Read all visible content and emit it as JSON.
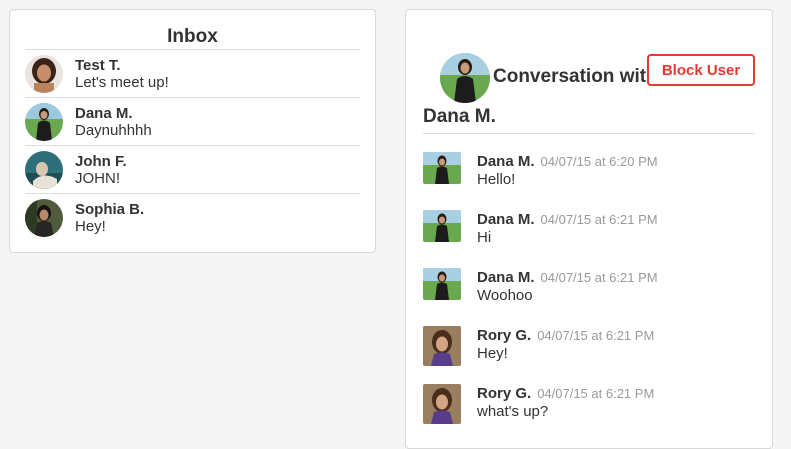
{
  "inbox": {
    "title": "Inbox",
    "items": [
      {
        "name": "Test T.",
        "message": "Let's meet up!"
      },
      {
        "name": "Dana M.",
        "message": "Daynuhhhh"
      },
      {
        "name": "John F.",
        "message": "JOHN!"
      },
      {
        "name": "Sophia B.",
        "message": "Hey!"
      }
    ]
  },
  "conversation": {
    "title_line1": "Conversation with",
    "title_line2": "Dana M.",
    "block_label": "Block User",
    "messages": [
      {
        "name": "Dana M.",
        "time": "04/07/15 at 6:20 PM",
        "text": "Hello!"
      },
      {
        "name": "Dana M.",
        "time": "04/07/15 at 6:21 PM",
        "text": "Hi"
      },
      {
        "name": "Dana M.",
        "time": "04/07/15 at 6:21 PM",
        "text": "Woohoo"
      },
      {
        "name": "Rory G.",
        "time": "04/07/15 at 6:21 PM",
        "text": "Hey!"
      },
      {
        "name": "Rory G.",
        "time": "04/07/15 at 6:21 PM",
        "text": "what's up?"
      }
    ]
  },
  "colors": {
    "accent_red": "#e53935",
    "timestamp": "#999999",
    "border": "#d8d8d8"
  }
}
